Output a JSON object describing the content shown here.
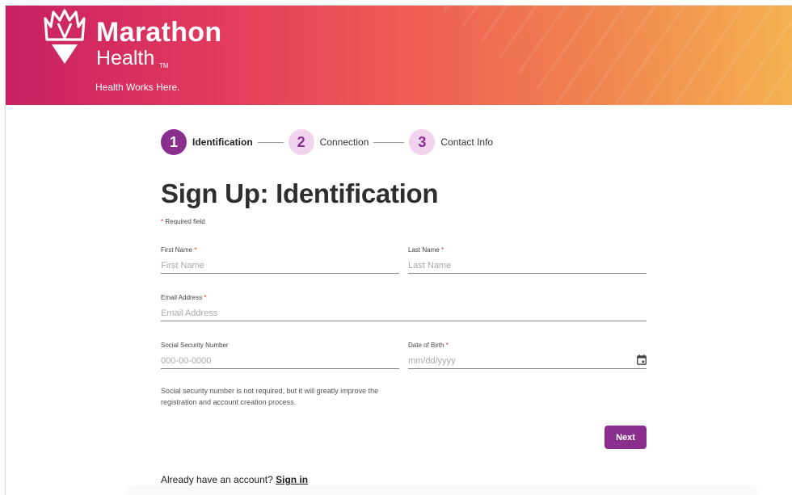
{
  "header": {
    "brand_name": "Marathon",
    "brand_sub": "Health",
    "brand_tm": "TM",
    "tagline": "Health Works Here.",
    "gradient_colors": [
      "#c81f63",
      "#e33c5c",
      "#ee5a54",
      "#f0844f",
      "#f5b250"
    ]
  },
  "stepper": {
    "steps": [
      {
        "number": "1",
        "label": "Identification",
        "state": "active"
      },
      {
        "number": "2",
        "label": "Connection",
        "state": "inactive"
      },
      {
        "number": "3",
        "label": "Contact Info",
        "state": "inactive"
      }
    ]
  },
  "form": {
    "title": "Sign Up: Identification",
    "required_marker": "*",
    "required_note": "Required field",
    "first_name": {
      "label": "First Name",
      "placeholder": "First Name",
      "value": ""
    },
    "last_name": {
      "label": "Last Name",
      "placeholder": "Last Name",
      "value": ""
    },
    "email": {
      "label": "Email Address",
      "placeholder": "Email Address",
      "value": ""
    },
    "ssn": {
      "label": "Social Security Number",
      "placeholder": "000-00-0000",
      "value": ""
    },
    "dob": {
      "label": "Date of Birth",
      "placeholder": "mm/dd/yyyy",
      "value": "",
      "icon": "calendar-icon"
    },
    "ssn_help": "Social security number is not required, but it will greatly improve the registration and account creation process.",
    "next_label": "Next"
  },
  "footer": {
    "signin_prompt": "Already have an account?",
    "signin_link": "Sign in"
  },
  "colors": {
    "accent": "#8b2f8f",
    "accent_light": "#f1d3ee",
    "required": "#d32f2f"
  }
}
